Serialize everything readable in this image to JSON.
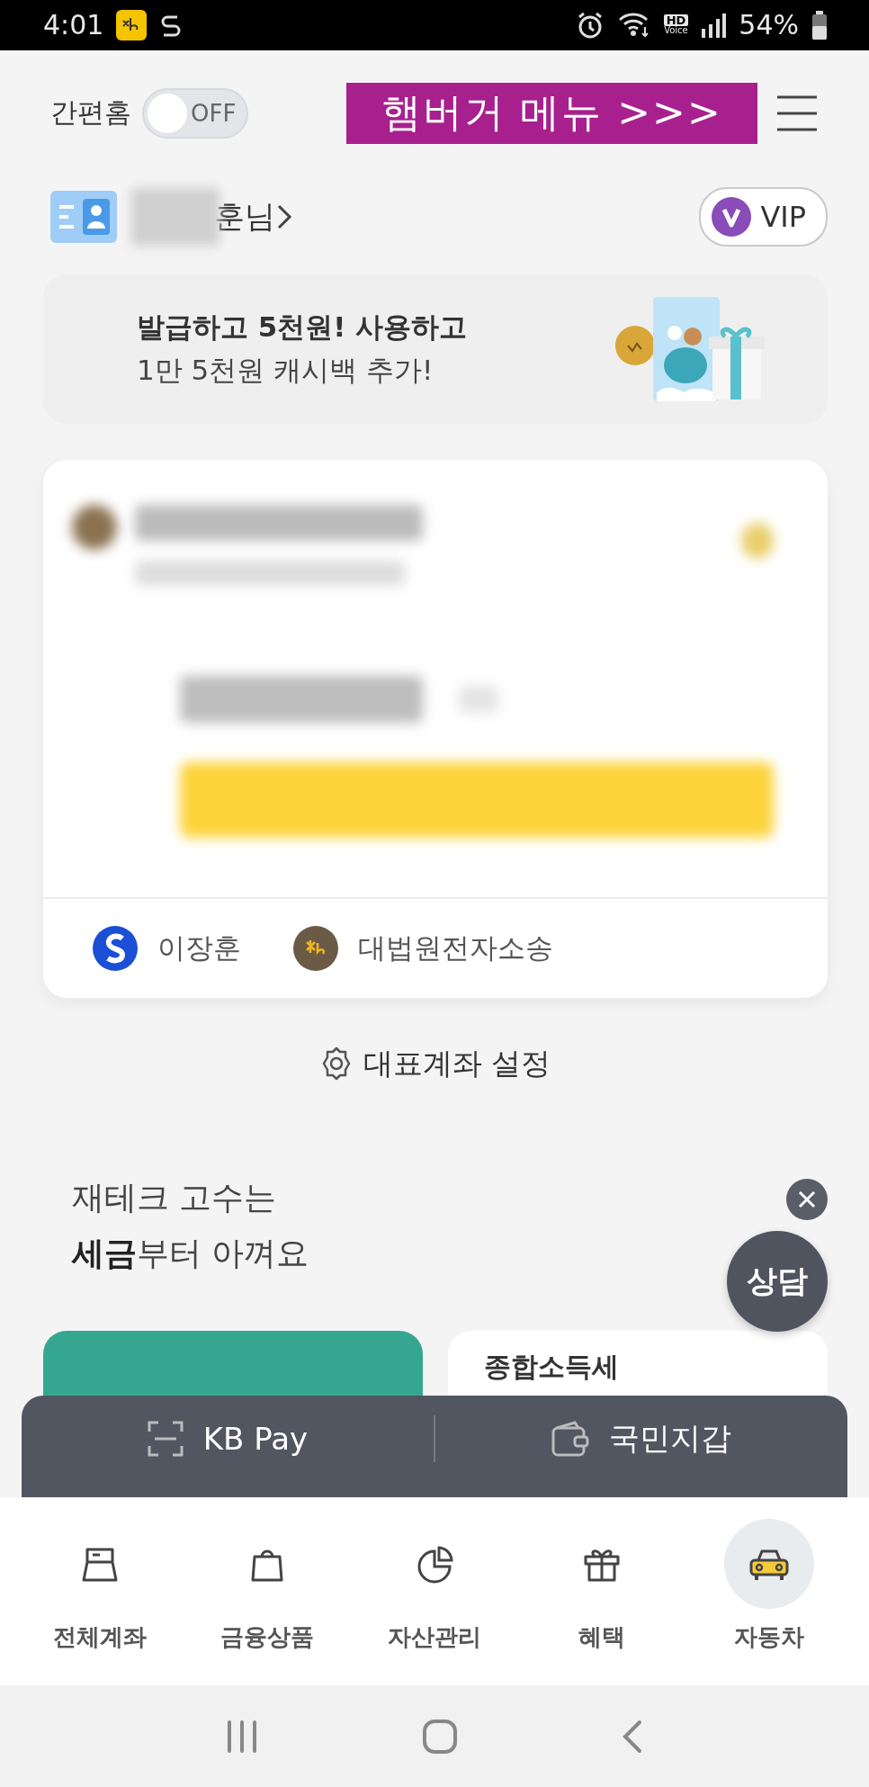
{
  "status_bar": {
    "time": "4:01",
    "hd_label": "HD",
    "voice_label": "Voice",
    "battery": "54%"
  },
  "header": {
    "simple_home_label": "간편홈",
    "toggle": {
      "on": false,
      "label": "OFF"
    },
    "annotation": "햄버거 메뉴 >>>"
  },
  "profile": {
    "name_visible": "훈님",
    "grade": "VIP"
  },
  "promo": {
    "line_1": "발급하고 5천원! 사용하고",
    "line_2": "1만 5천원 캐시백 추가!"
  },
  "account_card": {
    "linked": [
      {
        "kind": "shinhan",
        "name": "이장훈"
      },
      {
        "kind": "kb",
        "name": "대법원전자소송"
      }
    ]
  },
  "settings_link": "대표계좌 설정",
  "section": {
    "line_1": "재테크 고수는",
    "line_2": "**세금**부터 아껴요"
  },
  "cards": [
    {
      "kind": "featured"
    },
    {
      "kind": "plain",
      "title": "종합소득세"
    }
  ],
  "consult": {
    "label": "상담"
  },
  "pay_bar": [
    {
      "kind": "scan",
      "label": "KB Pay"
    },
    {
      "kind": "wallet",
      "label": "국민지갑"
    }
  ],
  "nav": [
    {
      "kind": "accounts",
      "label": "전체계좌",
      "selected": false
    },
    {
      "kind": "bag",
      "label": "금융상품",
      "selected": false
    },
    {
      "kind": "pie",
      "label": "자산관리",
      "selected": false
    },
    {
      "kind": "gift",
      "label": "혜택",
      "selected": false
    },
    {
      "kind": "car",
      "label": "자동차",
      "selected": true
    }
  ]
}
